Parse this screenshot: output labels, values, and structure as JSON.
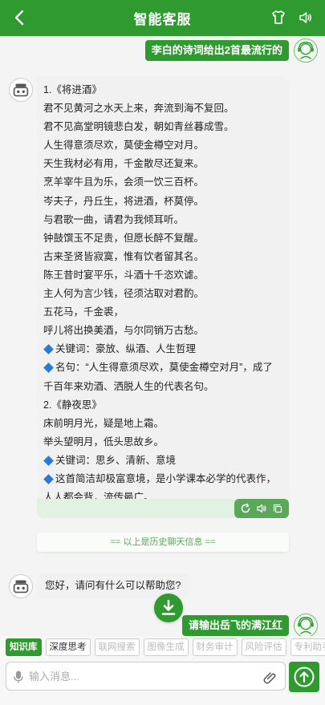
{
  "header": {
    "title": "智能客服"
  },
  "messages": {
    "user_1": "李白的诗词给出2首最流行的",
    "bot_1": [
      "1.《将进酒》",
      "君不见黄河之水天上来，奔流到海不复回。",
      "君不见高堂明镜悲白发，朝如青丝暮成雪。",
      "人生得意须尽欢，莫使金樽空对月。",
      "天生我材必有用，千金散尽还复来。",
      "烹羊宰牛且为乐，会须一饮三百杯。",
      "岑夫子，丹丘生，将进酒，杯莫停。",
      "与君歌一曲，请君为我倾耳听。",
      "钟鼓馔玉不足贵，但愿长醉不复醒。",
      "古来圣贤皆寂寞，惟有饮者留其名。",
      "陈王昔时宴平乐，斗酒十千恣欢谑。",
      "主人何为言少钱，径须沽取对君酌。",
      "五花马，千金裘，",
      "呼儿将出换美酒，与尔同销万古愁。"
    ],
    "bot_1_kw1": "关键词：豪放、纵酒、人生哲理",
    "bot_1_quote": "名句：“人生得意须尽欢，莫使金樽空对月”，成了千百年来劝酒、洒脱人生的代表名句。",
    "bot_1_part2": [
      "2.《静夜思》",
      "床前明月光，疑是地上霜。",
      "举头望明月，低头思故乡。"
    ],
    "bot_1_kw2": "关键词：思乡、清新、意境",
    "bot_1_note": "这首简洁却极富意境，是小学课本必学的代表作，人人都会背，流传最广。",
    "history_divider": "== 以上是历史聊天信息 ==",
    "bot_2": "您好，请问有什么可以帮助您?",
    "user_2": "请输出岳飞的满江红"
  },
  "tools": [
    "知识库",
    "深度思考",
    "联网搜索",
    "图像生成",
    "财务审计",
    "风险评估",
    "专利助手"
  ],
  "input": {
    "placeholder": "输入消息..."
  },
  "colors": {
    "brand": "#2f9a2f",
    "bubble": "#f0f1f0",
    "diamond": "#2979d6"
  }
}
